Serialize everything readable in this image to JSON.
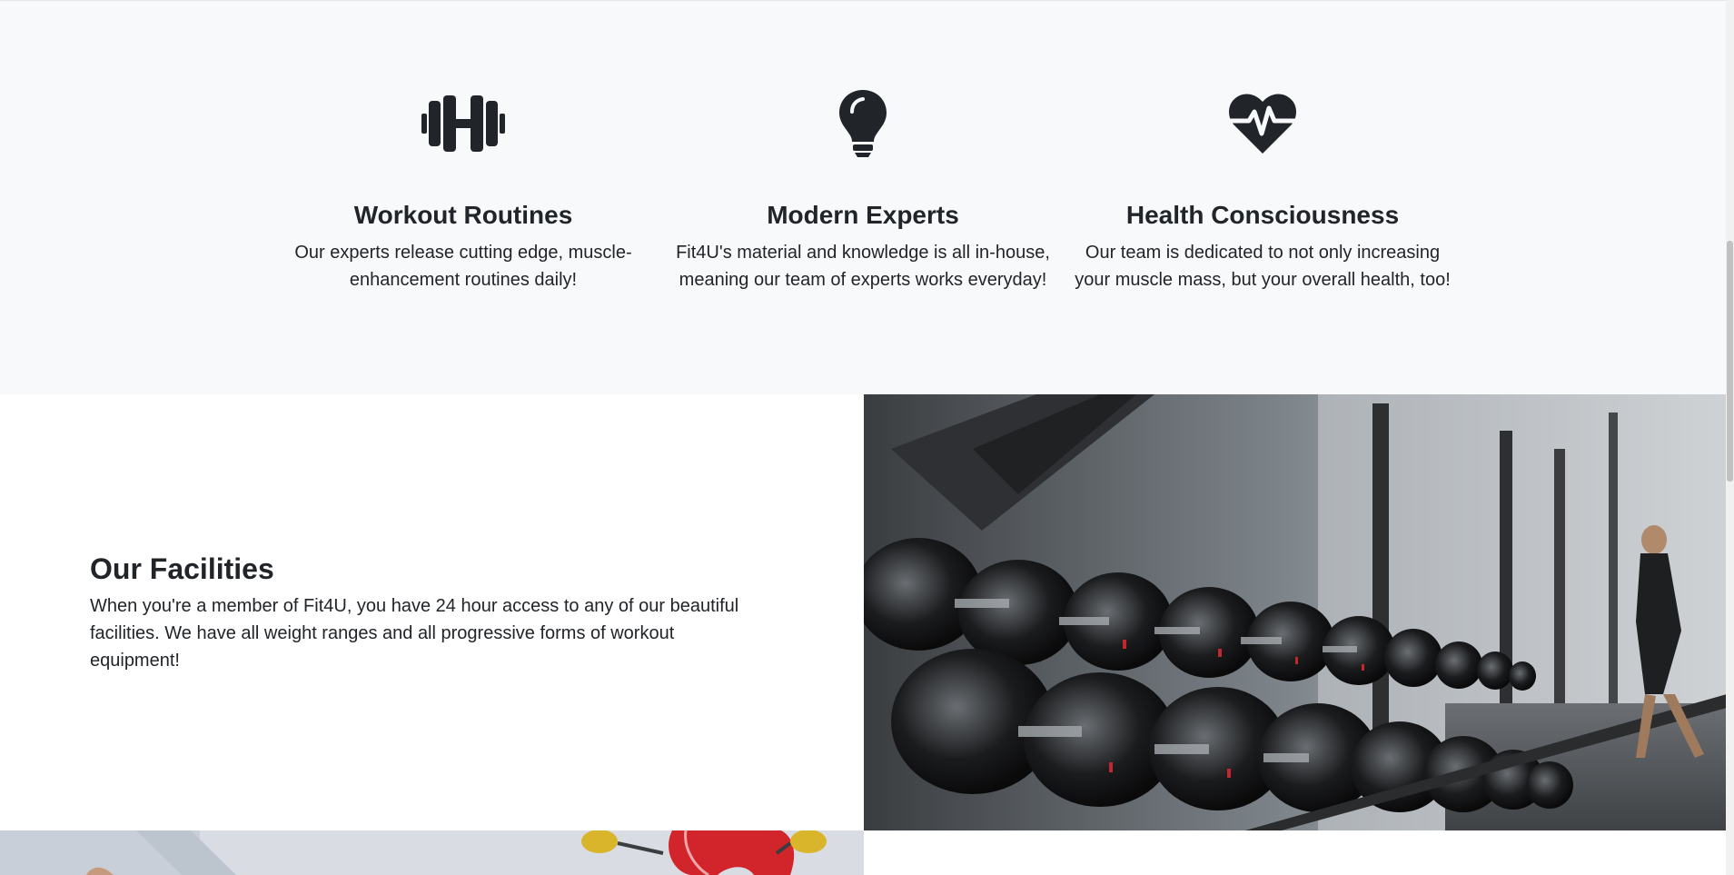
{
  "features": [
    {
      "icon": "dumbbell-icon",
      "title": "Workout Routines",
      "text": "Our experts release cutting edge, muscle-enhancement routines daily!"
    },
    {
      "icon": "lightbulb-icon",
      "title": "Modern Experts",
      "text": "Fit4U's material and knowledge is all in-house, meaning our team of experts works everyday!"
    },
    {
      "icon": "heart-pulse-icon",
      "title": "Health Consciousness",
      "text": "Our team is dedicated to not only increasing your muscle mass, but your overall health, too!"
    }
  ],
  "facilities": {
    "title": "Our Facilities",
    "text": "When you're a member of Fit4U, you have 24 hour access to any of our beautiful facilities. We have all weight ranges and all progressive forms of workout equipment!"
  },
  "colors": {
    "section_bg": "#f8f9fa",
    "text": "#212529"
  }
}
